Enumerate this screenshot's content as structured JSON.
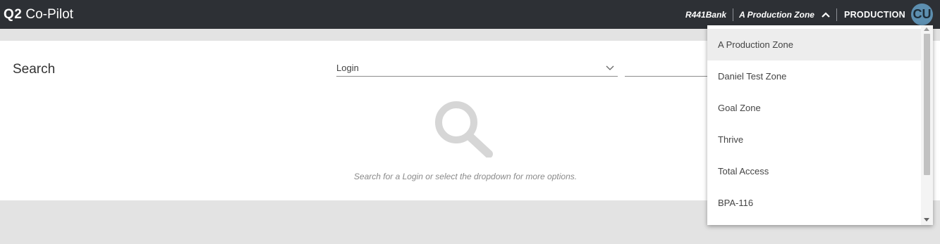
{
  "header": {
    "logo": "Q2",
    "app_name": "Co-Pilot",
    "bank_name": "R441Bank",
    "zone_selected": "A Production Zone",
    "environment": "PRODUCTION",
    "avatar_initials": "CU"
  },
  "search": {
    "title": "Search",
    "type_selected": "Login",
    "query_value": "",
    "empty_message": "Search for a Login or select the dropdown for more options."
  },
  "zone_dropdown": {
    "items": [
      {
        "label": "A Production Zone",
        "selected": true
      },
      {
        "label": "Daniel Test Zone",
        "selected": false
      },
      {
        "label": "Goal Zone",
        "selected": false
      },
      {
        "label": "Thrive",
        "selected": false
      },
      {
        "label": "Total Access",
        "selected": false
      },
      {
        "label": "BPA-116",
        "selected": false
      }
    ]
  },
  "colors": {
    "topbar": "#2d3035",
    "avatar": "#5d8fb0",
    "background": "#e3e3e3"
  }
}
